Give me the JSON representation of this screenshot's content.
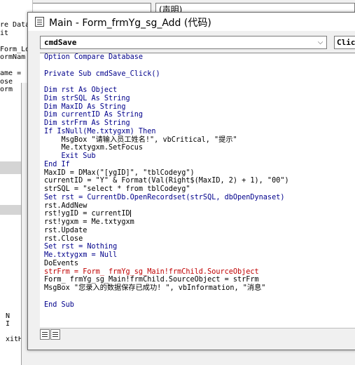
{
  "background": {
    "code_fragment": "re Data\nit\n\nForm_Lo\normNam\n\name = \nose\norm",
    "inner_fragment": "N\nI\n\nxitH",
    "declarations_label": "(声明)"
  },
  "window": {
    "title": "Main - Form_frmYg_sg_Add (代码)"
  },
  "toolbar": {
    "object_combo_value": "cmdSave",
    "procedure_combo_value": "Click"
  },
  "code": {
    "lines": [
      {
        "text": "Option Compare Database",
        "kind": "kw"
      },
      {
        "text": "",
        "kind": "blank"
      },
      {
        "text": "Private Sub cmdSave_Click()",
        "kind": "kw"
      },
      {
        "text": "",
        "kind": "blank"
      },
      {
        "text": "Dim rst As Object",
        "kind": "kw"
      },
      {
        "text": "Dim strSQL As String",
        "kind": "kw"
      },
      {
        "text": "Dim MaxID As String",
        "kind": "kw"
      },
      {
        "text": "Dim currentID As String",
        "kind": "kw"
      },
      {
        "text": "Dim strFrm As String",
        "kind": "kw"
      },
      {
        "text": "If IsNull(Me.txtygxm) Then",
        "kind": "kw"
      },
      {
        "text": "    MsgBox \"请输入员工姓名!\", vbCritical, \"提示\"",
        "kind": "normal"
      },
      {
        "text": "    Me.txtygxm.SetFocus",
        "kind": "normal"
      },
      {
        "text": "    Exit Sub",
        "kind": "kw"
      },
      {
        "text": "End If",
        "kind": "kw"
      },
      {
        "text": "MaxID = DMax(\"[ygID]\", \"tblCodeyg\")",
        "kind": "normal"
      },
      {
        "text": "currentID = \"Y\" & Format(Val(Right$(MaxID, 2) + 1), \"00\")",
        "kind": "normal"
      },
      {
        "text": "strSQL = \"select * from tblCodeyg\"",
        "kind": "normal"
      },
      {
        "text": "Set rst = CurrentDb.OpenRecordset(strSQL, dbOpenDynaset)",
        "kind": "kw"
      },
      {
        "text": "rst.AddNew",
        "kind": "normal"
      },
      {
        "text": "rst!ygID = currentID",
        "kind": "normal",
        "cursor": true
      },
      {
        "text": "rst!ygxm = Me.txtygxm",
        "kind": "normal"
      },
      {
        "text": "rst.Update",
        "kind": "normal"
      },
      {
        "text": "rst.Close",
        "kind": "normal"
      },
      {
        "text": "Set rst = Nothing",
        "kind": "kw"
      },
      {
        "text": "Me.txtygxm = Null",
        "kind": "kw"
      },
      {
        "text": "DoEvents",
        "kind": "normal"
      },
      {
        "text": "strFrm = Form_ frmYg_sg_Main!frmChild.SourceObject",
        "kind": "err"
      },
      {
        "text": "Form_ frmYg_sg_Main!frmChild.SourceObject = strFrm",
        "kind": "normal"
      },
      {
        "text": "MsgBox \"您录入的数据保存已成功! \", vbInformation, \"消息\"",
        "kind": "normal"
      },
      {
        "text": "",
        "kind": "blank"
      },
      {
        "text": "End Sub",
        "kind": "kw"
      }
    ]
  },
  "icons": {
    "window_icon": "code-window-icon",
    "combo_arrow": "chevron-down-icon",
    "procedure_view": "procedure-view-icon",
    "full_module_view": "full-module-view-icon"
  },
  "colors": {
    "keyword": "#00008b",
    "error": "#c00000",
    "text": "#000000"
  }
}
